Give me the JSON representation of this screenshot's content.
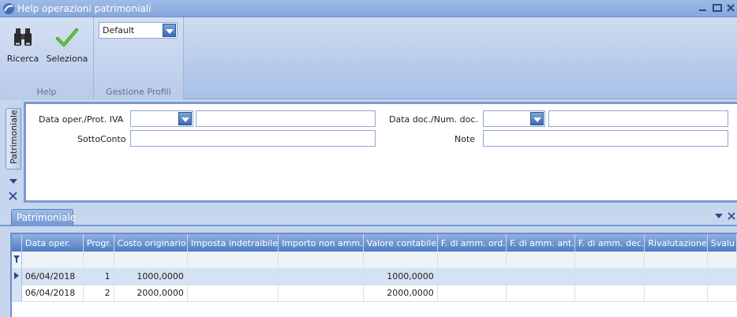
{
  "window": {
    "title": "Help operazioni patrimoniali"
  },
  "ribbon": {
    "help_group": {
      "label": "Help",
      "buttons": [
        {
          "label": "Ricerca",
          "icon": "binoculars-icon"
        },
        {
          "label": "Seleziona",
          "icon": "checkmark-icon"
        }
      ]
    },
    "profile_group": {
      "label": "Gestione Profili",
      "profile_selected": "Default"
    }
  },
  "filter_panel": {
    "side_tab": "Patrimoniale",
    "fields": {
      "data_oper_label": "Data oper./Prot. IVA",
      "sottoconto_label": "SottoConto",
      "data_doc_label": "Data doc./Num. doc.",
      "note_label": "Note"
    }
  },
  "grid_panel": {
    "tab": "Patrimoniale",
    "columns": [
      "Data oper.",
      "Progr.",
      "Costo originario",
      "Imposta indetraibile",
      "Importo non amm.",
      "Valore contabile",
      "F. di amm. ord.",
      "F. di amm. ant.",
      "F. di amm. dec.",
      "Rivalutazione",
      "Svalu"
    ],
    "rows": [
      [
        "06/04/2018",
        "1",
        "1000,0000",
        "",
        "",
        "1000,0000",
        "",
        "",
        "",
        "",
        ""
      ],
      [
        "06/04/2018",
        "2",
        "2000,0000",
        "",
        "",
        "2000,0000",
        "",
        "",
        "",
        "",
        ""
      ]
    ]
  },
  "colors": {
    "accent": "#4f7cc2",
    "ribbon": "#b9cbea",
    "title_bar": "#86a6db"
  }
}
